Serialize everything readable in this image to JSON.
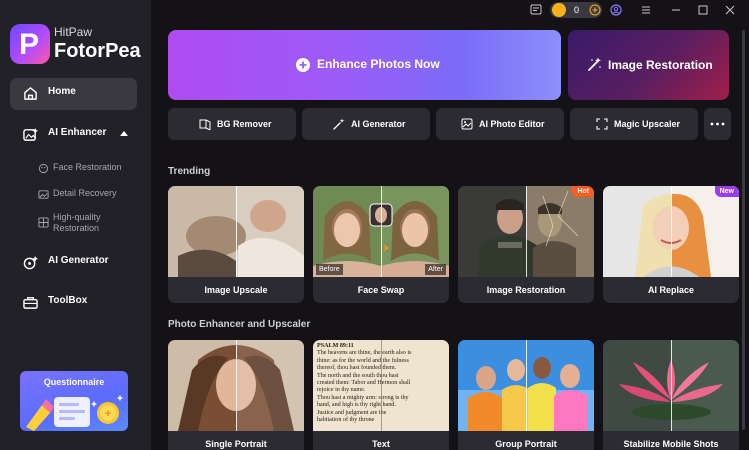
{
  "brand": {
    "line1": "HitPaw",
    "line2": "FotorPea",
    "logo_letter": "P"
  },
  "sidebar": {
    "home": "Home",
    "ai_enhancer": "AI Enhancer",
    "sub": [
      "Face Restoration",
      "Detail Recovery",
      "High-quality Restoration"
    ],
    "ai_generator": "AI Generator",
    "toolbox": "ToolBox",
    "questionnaire": "Questionnaire"
  },
  "topbar": {
    "coins": "0"
  },
  "hero": {
    "enhance": "Enhance Photos Now",
    "restore": "Image Restoration"
  },
  "tools": [
    "BG Remover",
    "AI Generator",
    "AI Photo Editor",
    "Magic Upscaler"
  ],
  "sections": {
    "trending": "Trending",
    "photo": "Photo Enhancer and Upscaler"
  },
  "trending": [
    {
      "label": "Image Upscale"
    },
    {
      "label": "Face Swap",
      "tag_before": "Before",
      "tag_after": "After"
    },
    {
      "label": "Image Restoration",
      "badge": "Hot"
    },
    {
      "label": "AI Replace",
      "badge": "New"
    }
  ],
  "photo": [
    {
      "label": "Single Portrait"
    },
    {
      "label": "Text",
      "text_lines": [
        "PSALM 89:11",
        "The heavens are thine, the earth also is",
        "thine: as for the world and the fulness",
        "thereof, thou hast founded them.",
        "The north and the south thou hast",
        "created them: Tabor and Hermon shall",
        "rejoice in thy name.",
        "Thou hast a mighty arm: strong is thy",
        "hand, and high is thy right hand.",
        "Justice and judgment are the",
        "habitation of thy throne"
      ]
    },
    {
      "label": "Group Portrait"
    },
    {
      "label": "Stabilize Mobile Shots"
    }
  ],
  "colors": {
    "hot": "#ff5a1f",
    "new": "#9b3cf2",
    "accent": "#9b5cf8"
  }
}
